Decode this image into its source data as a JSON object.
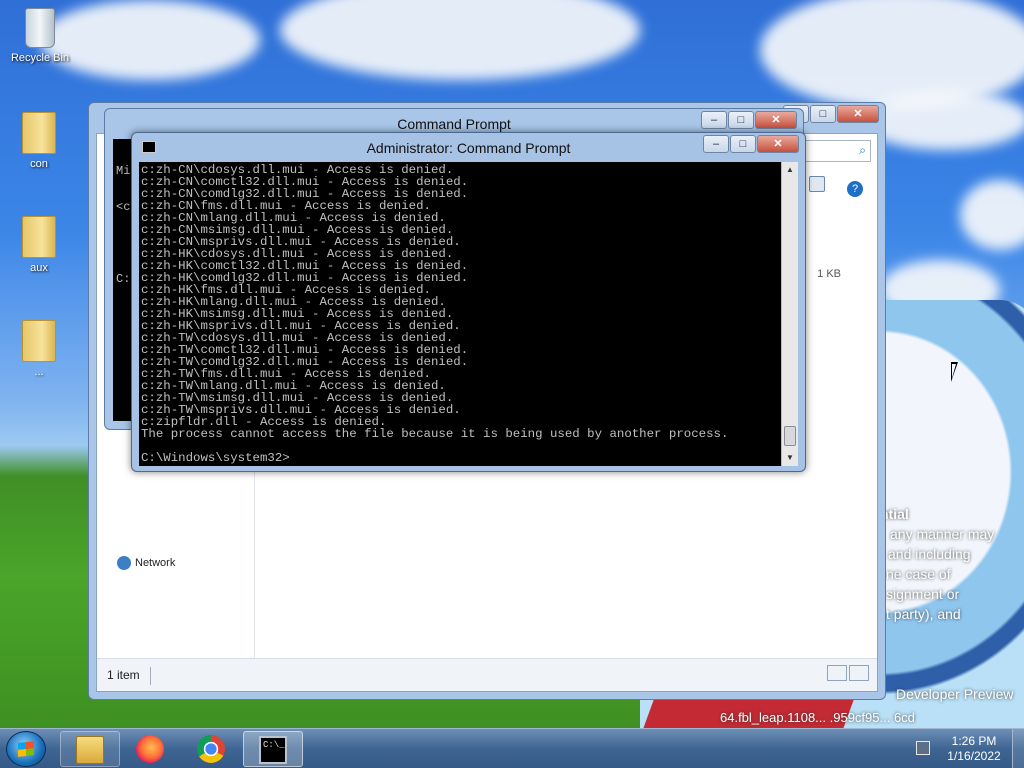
{
  "desktop": {
    "icons": [
      {
        "label": "Recycle Bin",
        "icon": "recycle-bin-icon"
      },
      {
        "label": "con",
        "icon": "folder-icon"
      },
      {
        "label": "aux",
        "icon": "folder-icon"
      },
      {
        "label": "...",
        "icon": "folder-icon"
      }
    ],
    "wallpaper_text": {
      "line1": "ntial",
      "line2": "any manner may",
      "line3": "and including",
      "line4": "ne case of",
      "line5": "signment or",
      "line6": "t party), and",
      "build1": "Developer Preview",
      "build2": "64.fbl_leap.1108... .959cf95... 6cd"
    }
  },
  "explorer": {
    "size_text": "1 KB",
    "network_label": "Network",
    "status_text": "1 item"
  },
  "cmd_back": {
    "title": "Command Prompt",
    "lines": [
      "Mi",
      "<c",
      "",
      "C:"
    ]
  },
  "cmd_admin": {
    "title": "Administrator: Command Prompt",
    "lines": [
      "c:zh-CN\\cdosys.dll.mui - Access is denied.",
      "c:zh-CN\\comctl32.dll.mui - Access is denied.",
      "c:zh-CN\\comdlg32.dll.mui - Access is denied.",
      "c:zh-CN\\fms.dll.mui - Access is denied.",
      "c:zh-CN\\mlang.dll.mui - Access is denied.",
      "c:zh-CN\\msimsg.dll.mui - Access is denied.",
      "c:zh-CN\\msprivs.dll.mui - Access is denied.",
      "c:zh-HK\\cdosys.dll.mui - Access is denied.",
      "c:zh-HK\\comctl32.dll.mui - Access is denied.",
      "c:zh-HK\\comdlg32.dll.mui - Access is denied.",
      "c:zh-HK\\fms.dll.mui - Access is denied.",
      "c:zh-HK\\mlang.dll.mui - Access is denied.",
      "c:zh-HK\\msimsg.dll.mui - Access is denied.",
      "c:zh-HK\\msprivs.dll.mui - Access is denied.",
      "c:zh-TW\\cdosys.dll.mui - Access is denied.",
      "c:zh-TW\\comctl32.dll.mui - Access is denied.",
      "c:zh-TW\\comdlg32.dll.mui - Access is denied.",
      "c:zh-TW\\fms.dll.mui - Access is denied.",
      "c:zh-TW\\mlang.dll.mui - Access is denied.",
      "c:zh-TW\\msimsg.dll.mui - Access is denied.",
      "c:zh-TW\\msprivs.dll.mui - Access is denied.",
      "c:zipfldr.dll - Access is denied.",
      "The process cannot access the file because it is being used by another process."
    ],
    "prompt": "C:\\Windows\\system32>"
  },
  "window_buttons": {
    "minimize": "‒",
    "maximize": "□",
    "close": "✕"
  },
  "taskbar": {
    "apps": [
      {
        "name": "Windows Explorer",
        "icon": "folder-icon",
        "state": "pinned"
      },
      {
        "name": "Firefox",
        "icon": "firefox-icon",
        "state": "pinned"
      },
      {
        "name": "Google Chrome",
        "icon": "chrome-icon",
        "state": "pinned"
      },
      {
        "name": "Command Prompt",
        "icon": "cmd-icon",
        "state": "active"
      }
    ],
    "time": "1:26 PM",
    "date": "1/16/2022"
  },
  "colors": {
    "console_bg": "#000000",
    "console_fg": "#c0c0c0",
    "taskbar": "#3f6593",
    "close_button": "#c7503d"
  }
}
